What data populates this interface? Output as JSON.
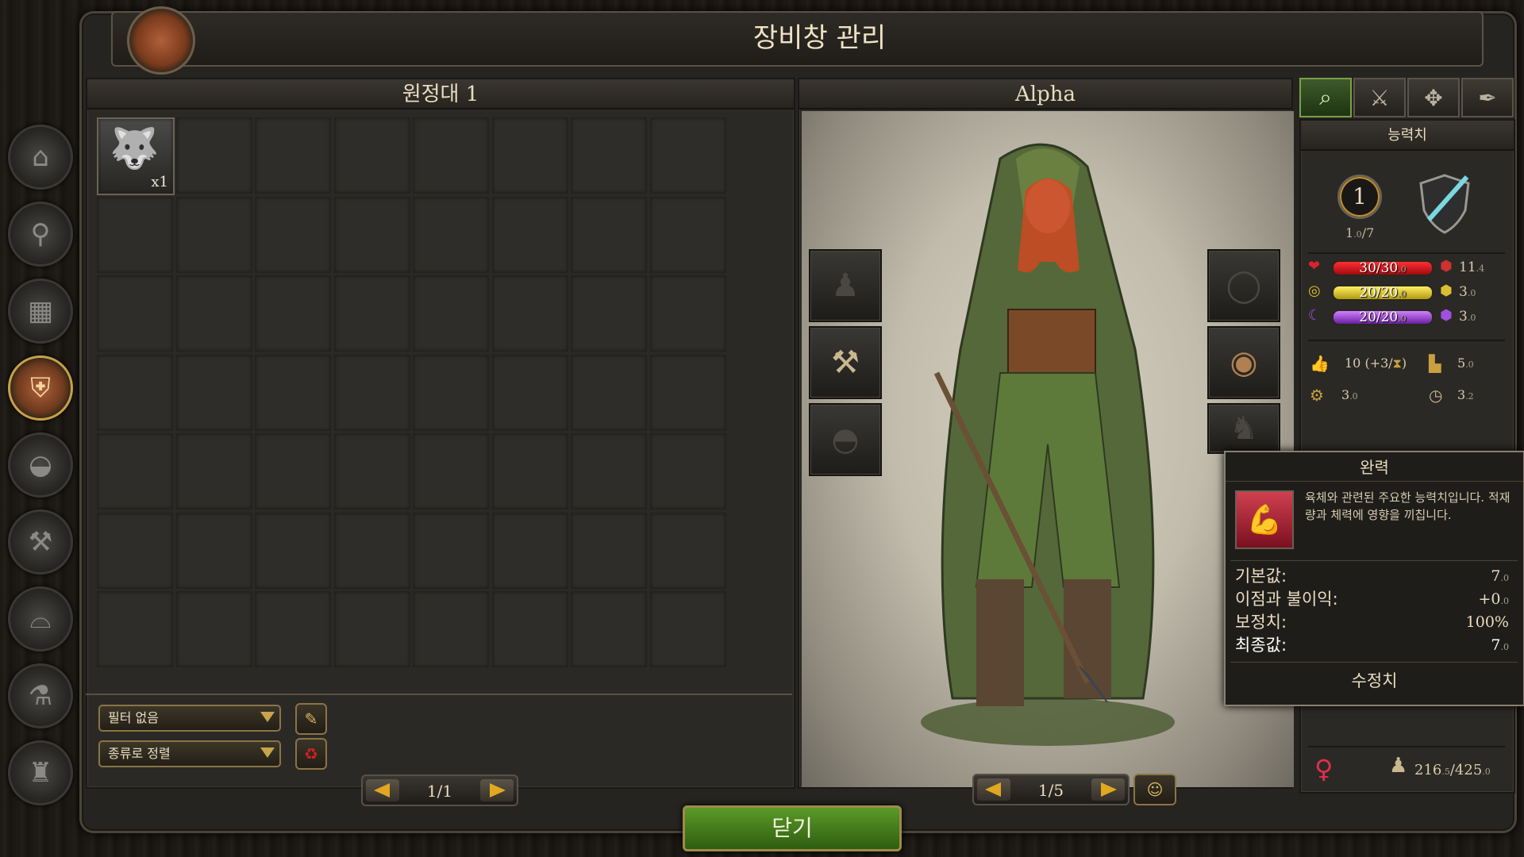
{
  "window": {
    "title": "장비창 관리"
  },
  "sidebar": {
    "items": [
      {
        "name": "house",
        "glyph": "⌂"
      },
      {
        "name": "magnifier",
        "glyph": "🔍"
      },
      {
        "name": "crate",
        "glyph": "▦"
      },
      {
        "name": "shield-sword",
        "glyph": "⛨"
      },
      {
        "name": "cauldron",
        "glyph": "◒"
      },
      {
        "name": "anvil",
        "glyph": "⚒"
      },
      {
        "name": "furnace",
        "glyph": "⌓"
      },
      {
        "name": "flask",
        "glyph": "⚗"
      },
      {
        "name": "candle",
        "glyph": "🕯"
      }
    ],
    "active_index": 3
  },
  "inventory": {
    "title": "원정대 1",
    "items": [
      {
        "icon": "wolf-icon",
        "count": "x1"
      }
    ],
    "filter_label": "필터 없음",
    "sort_label": "종류로 정렬",
    "pager": "1/1"
  },
  "character": {
    "name": "Alpha",
    "pager": "1/5",
    "left_slots": [
      "chest-armor-slot",
      "hammer-weapon-slot",
      "helmet-slot"
    ],
    "right_slots": [
      "ring-slot",
      "round-shield-slot",
      "pet-slot"
    ]
  },
  "stats": {
    "tabs": [
      "search",
      "crossed-swords",
      "emblem",
      "quill"
    ],
    "header": "능력치",
    "level": "1",
    "xp_main": "1",
    "xp_sub": ".0",
    "xp_max": "/7",
    "health": {
      "text": "30/30",
      "sub": ".0",
      "color": "#c8141a"
    },
    "stamina": {
      "text": "20/20",
      "sub": ".0",
      "color": "#e0c820"
    },
    "mana": {
      "text": "20/20",
      "sub": ".0",
      "color": "#a050e0"
    },
    "health_armor": {
      "main": "11",
      "sub": ".4"
    },
    "stamina_armor": {
      "main": "3",
      "sub": ".0"
    },
    "mana_armor": {
      "main": "3",
      "sub": ".0"
    },
    "morale": "10 (+3/",
    "morale_tail": ")",
    "speed": {
      "main": "5",
      "sub": ".0"
    },
    "skill": {
      "main": "3",
      "sub": ".0"
    },
    "time": {
      "main": "3",
      "sub": ".2"
    },
    "weight_main": "216",
    "weight_sub": ".5",
    "weight_max": "/425",
    "weight_max_sub": ".0"
  },
  "tooltip": {
    "title": "완력",
    "description": "육체와 관련된 주요한 능력치입니다. 적재량과 체력에 영향을 끼칩니다.",
    "rows": [
      {
        "label": "기본값:",
        "value": "7",
        "sub": ".0"
      },
      {
        "label": "이점과 불이익:",
        "value": "+0",
        "sub": ".0"
      },
      {
        "label": "보정치:",
        "value": "100%",
        "sub": ""
      },
      {
        "label": "최종값:",
        "value": "7",
        "sub": ".0"
      }
    ],
    "footer": "수정치"
  },
  "close_label": "닫기",
  "colors": {
    "accent_gold": "#c8a44a",
    "close_green": "#4a8a20"
  }
}
